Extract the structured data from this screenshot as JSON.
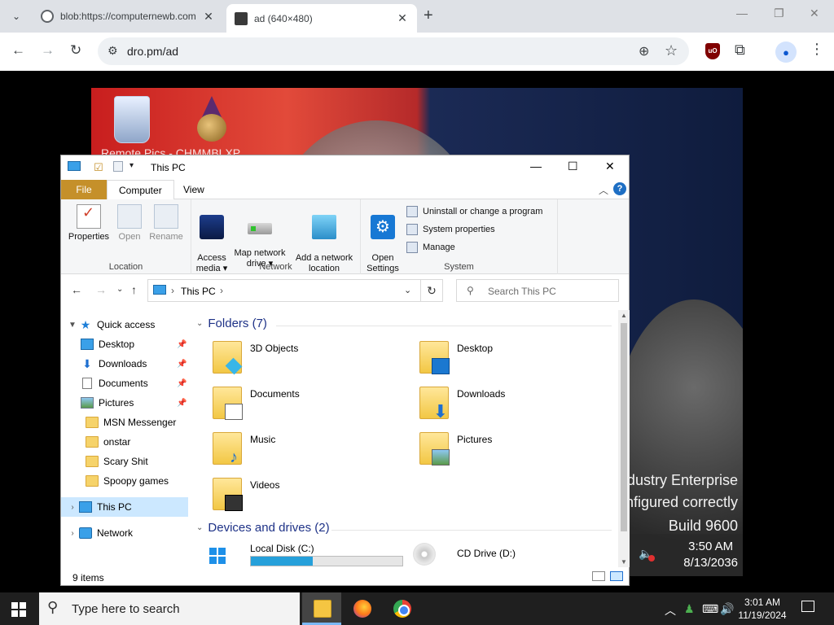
{
  "browser": {
    "tabs": [
      {
        "title": "blob:https://computernewb.com",
        "active": false
      },
      {
        "title": "ad (640×480)",
        "active": true
      }
    ],
    "url": "dro.pm/ad"
  },
  "remote": {
    "desktop_label": "Remote Pics - CHMMBLXP",
    "watermark": [
      "ndustry Enterprise",
      "nfigured correctly",
      "Build 9600"
    ],
    "clock_time": "3:50 AM",
    "clock_date": "8/13/2036"
  },
  "explorer": {
    "title": "This PC",
    "tabs": {
      "file": "File",
      "computer": "Computer",
      "view": "View"
    },
    "ribbon": {
      "location": {
        "name": "Location",
        "properties": "Properties",
        "open": "Open",
        "rename": "Rename"
      },
      "network": {
        "name": "Network",
        "access_media": "Access\nmedia ▾",
        "map_drive": "Map network\ndrive ▾",
        "add_location": "Add a network\nlocation"
      },
      "system": {
        "name": "System",
        "open_settings": "Open\nSettings",
        "uninstall": "Uninstall or change a program",
        "sys_props": "System properties",
        "manage": "Manage"
      }
    },
    "address": {
      "crumb": "This PC",
      "search_placeholder": "Search This PC"
    },
    "nav": [
      {
        "label": "Quick access",
        "icon": "star-icon",
        "expanded": true
      },
      {
        "label": "Desktop",
        "icon": "desktop-icon",
        "pinned": true
      },
      {
        "label": "Downloads",
        "icon": "download-icon",
        "pinned": true
      },
      {
        "label": "Documents",
        "icon": "document-icon",
        "pinned": true
      },
      {
        "label": "Pictures",
        "icon": "picture-icon",
        "pinned": true
      },
      {
        "label": "MSN Messenger",
        "icon": "folder-icon"
      },
      {
        "label": "onstar",
        "icon": "folder-icon"
      },
      {
        "label": "Scary Shit",
        "icon": "folder-icon"
      },
      {
        "label": "Spoopy games",
        "icon": "folder-icon"
      },
      {
        "label": "This PC",
        "icon": "computer-icon",
        "selected": true
      },
      {
        "label": "Network",
        "icon": "network-icon"
      }
    ],
    "folders_header": "Folders (7)",
    "folders": [
      "3D Objects",
      "Desktop",
      "Documents",
      "Downloads",
      "Music",
      "Pictures",
      "Videos"
    ],
    "devices_header": "Devices and drives (2)",
    "drives": [
      {
        "name": "Local Disk (C:)",
        "used_fraction": 0.41
      },
      {
        "name": "CD Drive (D:)"
      }
    ],
    "status": "9 items"
  },
  "taskbar": {
    "search_placeholder": "Type here to search",
    "time": "3:01 AM",
    "date": "11/19/2024"
  },
  "colors": {
    "file_tab": "#c5902a",
    "selection": "#cce8ff",
    "group_header": "#1e3287",
    "drive_fill": "#26a0da"
  }
}
